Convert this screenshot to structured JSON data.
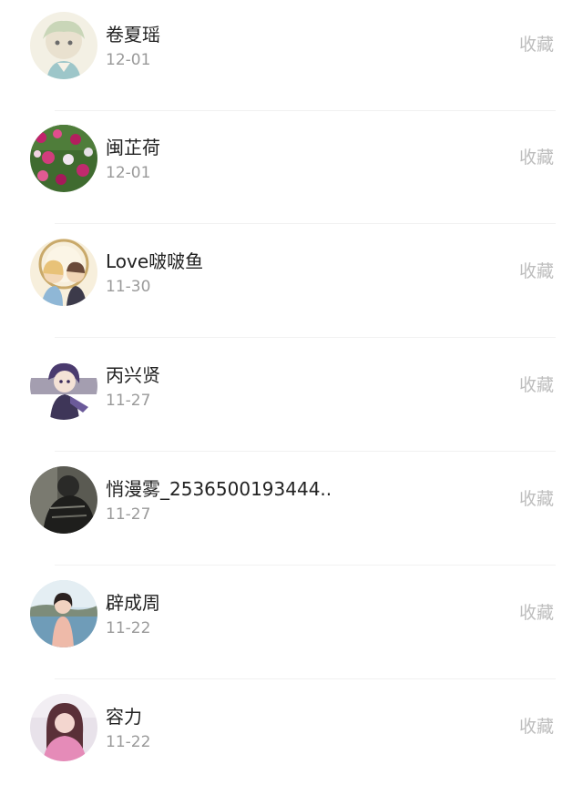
{
  "list": {
    "items": [
      {
        "name": "卷夏瑶",
        "date": "12-01",
        "action": "收藏"
      },
      {
        "name": "闽芷荷",
        "date": "12-01",
        "action": "收藏"
      },
      {
        "name": "Love啵啵鱼",
        "date": "11-30",
        "action": "收藏"
      },
      {
        "name": "丙兴贤",
        "date": "11-27",
        "action": "收藏"
      },
      {
        "name": "悄漫雾_2536500193444...",
        "date": "11-27",
        "action": "收藏"
      },
      {
        "name": "辟成周",
        "date": "11-22",
        "action": "收藏"
      },
      {
        "name": "容力",
        "date": "11-22",
        "action": "收藏"
      }
    ]
  }
}
